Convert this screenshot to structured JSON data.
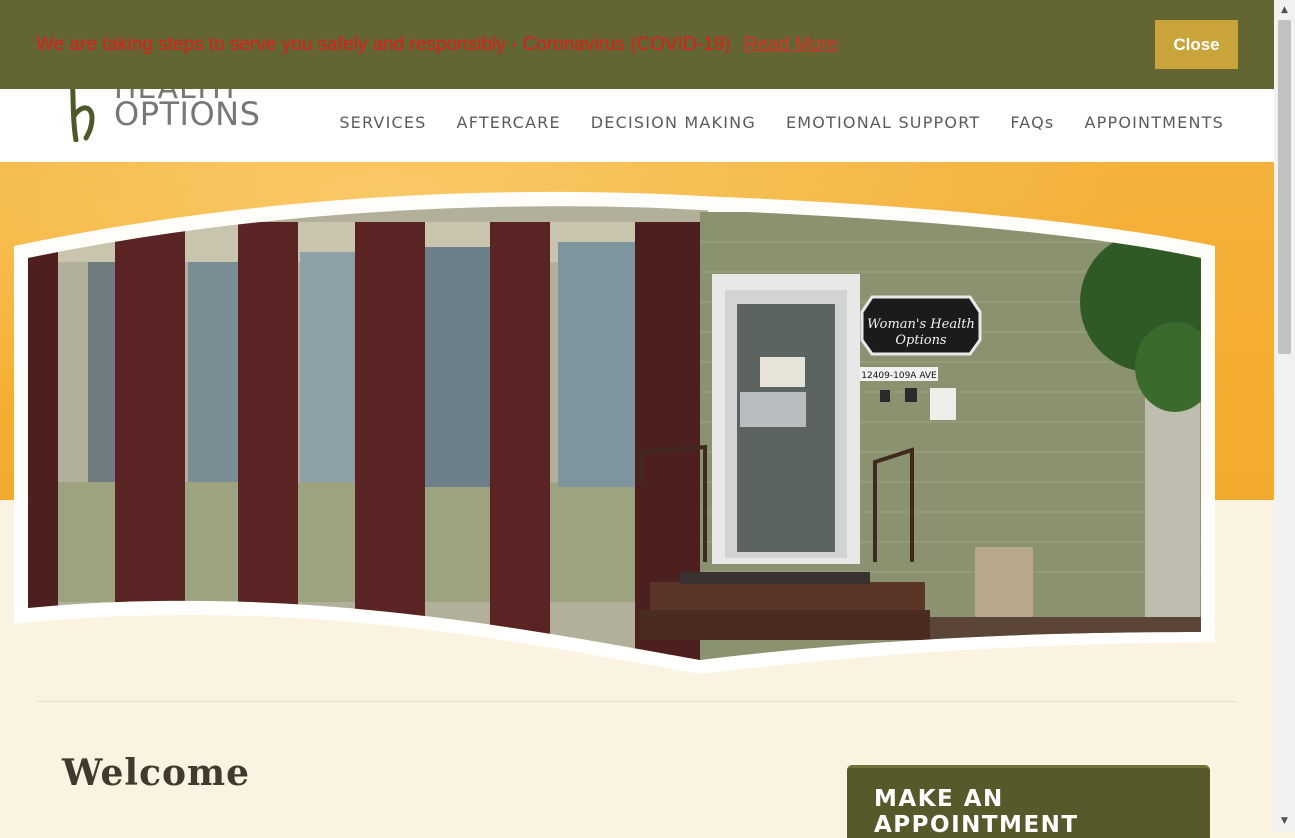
{
  "banner": {
    "message": "We are taking steps to serve you safely and responsibly - Coronavirus (COVID-19)",
    "link_label": "Read More",
    "close_label": "Close"
  },
  "logo": {
    "line1": "HEALTH",
    "line2": "OPTIONS"
  },
  "nav": {
    "items": [
      "SERVICES",
      "AFTERCARE",
      "DECISION MAKING",
      "EMOTIONAL SUPPORT",
      "FAQs",
      "APPOINTMENTS"
    ]
  },
  "hero": {
    "sign_line1": "Woman's Health",
    "sign_line2": "Options",
    "address": "12409-109A AVE"
  },
  "main": {
    "welcome_title": "Welcome",
    "appointment_button": "MAKE AN APPOINTMENT"
  },
  "colors": {
    "banner_bg": "#636532",
    "banner_text": "#e21b1b",
    "close_button": "#c9a43a",
    "hero_band": "#f5ad30",
    "page_bg": "#fbf3e1",
    "appointment_bg": "#58592a"
  }
}
